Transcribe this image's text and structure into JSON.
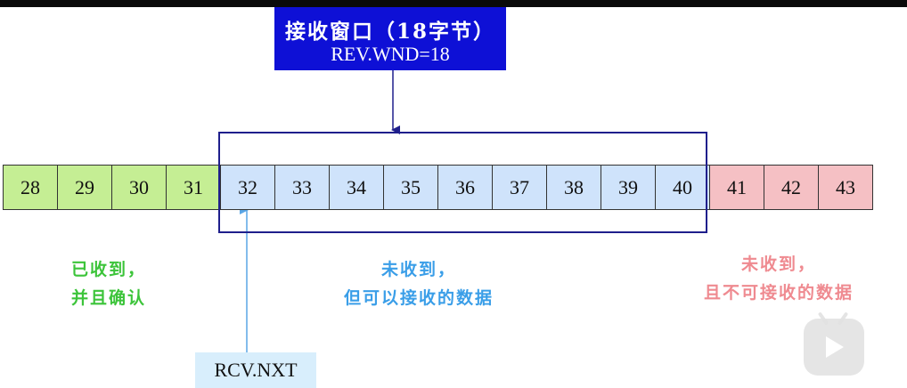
{
  "window_label": {
    "title": "接收窗口（18字节）",
    "value": "REV.WND=18"
  },
  "bytes": {
    "acked": [
      "28",
      "29",
      "30",
      "31"
    ],
    "window": [
      "32",
      "33",
      "34",
      "35",
      "36",
      "37",
      "38",
      "39",
      "40"
    ],
    "blocked": [
      "41",
      "42",
      "43"
    ]
  },
  "captions": {
    "acked": [
      "已收到，",
      "并且确认"
    ],
    "window": [
      "未收到，",
      "但可以接收的数据"
    ],
    "blocked": [
      "未收到，",
      "且不可接收的数据"
    ]
  },
  "pointer": {
    "label": "RCV.NXT"
  },
  "colors": {
    "acked": "#c5ee94",
    "window": "#cfe3fb",
    "blocked": "#f5c0c4",
    "label_box": "#0e10d6",
    "window_frame": "#1f1f8c",
    "acked_text": "#3cc43a",
    "window_text": "#3a9ee8",
    "blocked_text": "#ef8a90"
  },
  "icons": {
    "watermark": "play-tv-icon"
  }
}
